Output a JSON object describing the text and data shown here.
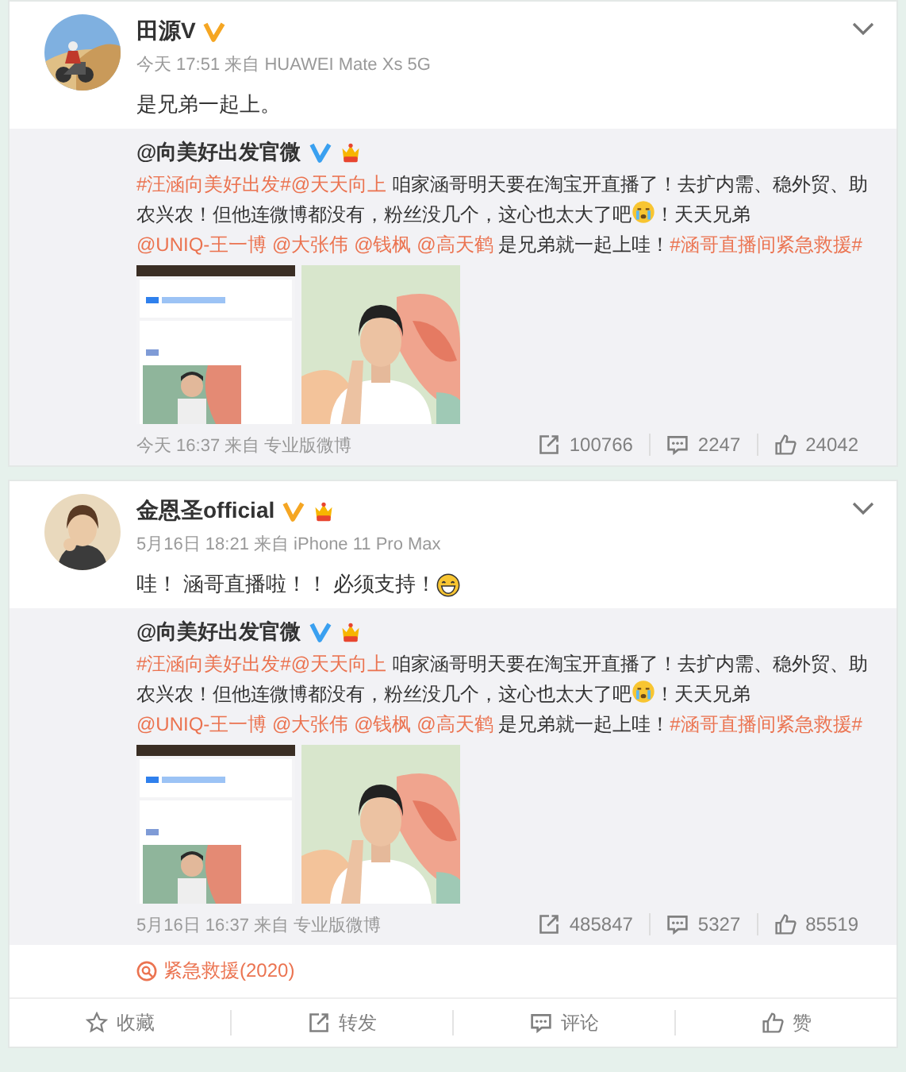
{
  "posts": [
    {
      "author": "田源V",
      "badges": [
        {
          "kind": "verified",
          "color": "#f5a623"
        }
      ],
      "meta": "今天 17:51 来自 HUAWEI Mate Xs 5G",
      "text": [
        {
          "kind": "plain",
          "text": "是兄弟一起上。"
        }
      ],
      "retweet": {
        "author": "@向美好出发官微",
        "badges": [
          {
            "kind": "verified",
            "color": "#3aa0f0"
          },
          {
            "kind": "crown"
          }
        ],
        "text": [
          {
            "kind": "link",
            "text": "#汪涵向美好出发#"
          },
          {
            "kind": "link",
            "text": "@天天向上"
          },
          {
            "kind": "plain",
            "text": " 咱家涵哥明天要在淘宝开直播了！去扩内需、稳外贸、助农兴农！但他连微博都没有，粉丝没几个，这心也太大了吧"
          },
          {
            "kind": "crying-emoji"
          },
          {
            "kind": "plain",
            "text": "！天天兄弟 "
          },
          {
            "kind": "mentions",
            "names": [
              "@UNIQ-王一博",
              "@大张伟",
              "@钱枫",
              "@高天鹤"
            ]
          },
          {
            "kind": "plain",
            "text": " 是兄弟就一起上哇！"
          },
          {
            "kind": "link",
            "text": "#涵哥直播间紧急救援#"
          }
        ],
        "images": [
          {
            "kind": "screenshot"
          },
          {
            "kind": "poster"
          }
        ],
        "meta": "今天 16:37 来自 专业版微博",
        "stats": [
          {
            "kind": "repost",
            "count": "100766"
          },
          {
            "kind": "comment",
            "count": "2247"
          },
          {
            "kind": "like",
            "count": "24042"
          }
        ]
      }
    },
    {
      "author": "金恩圣official",
      "badges": [
        {
          "kind": "verified",
          "color": "#f5a623"
        },
        {
          "kind": "crown"
        }
      ],
      "meta": "5月16日 18:21 来自 iPhone 11 Pro Max",
      "text": [
        {
          "kind": "plain",
          "text": "哇！ 涵哥直播啦！！ 必须支持！ "
        },
        {
          "kind": "grinning-emoji"
        }
      ],
      "retweet": {
        "author": "@向美好出发官微",
        "badges": [
          {
            "kind": "verified",
            "color": "#3aa0f0"
          },
          {
            "kind": "crown"
          }
        ],
        "text": [
          {
            "kind": "link",
            "text": "#汪涵向美好出发#"
          },
          {
            "kind": "link",
            "text": "@天天向上"
          },
          {
            "kind": "plain",
            "text": " 咱家涵哥明天要在淘宝开直播了！去扩内需、稳外贸、助农兴农！但他连微博都没有，粉丝没几个，这心也太大了吧"
          },
          {
            "kind": "crying-emoji"
          },
          {
            "kind": "plain",
            "text": "！天天兄弟 "
          },
          {
            "kind": "mentions",
            "names": [
              "@UNIQ-王一博",
              "@大张伟",
              "@钱枫",
              "@高天鹤"
            ]
          },
          {
            "kind": "plain",
            "text": " 是兄弟就一起上哇！"
          },
          {
            "kind": "link",
            "text": "#涵哥直播间紧急救援#"
          }
        ],
        "images": [
          {
            "kind": "screenshot"
          },
          {
            "kind": "poster"
          }
        ],
        "meta": "5月16日 16:37 来自 专业版微博",
        "stats": [
          {
            "kind": "repost",
            "count": "485847"
          },
          {
            "kind": "comment",
            "count": "5327"
          },
          {
            "kind": "like",
            "count": "85519"
          }
        ]
      },
      "topic": "紧急救援(2020)",
      "actions": [
        {
          "kind": "favorite",
          "label": "收藏"
        },
        {
          "kind": "repost",
          "label": "转发"
        },
        {
          "kind": "comment",
          "label": "评论"
        },
        {
          "kind": "like",
          "label": "赞"
        }
      ]
    }
  ]
}
